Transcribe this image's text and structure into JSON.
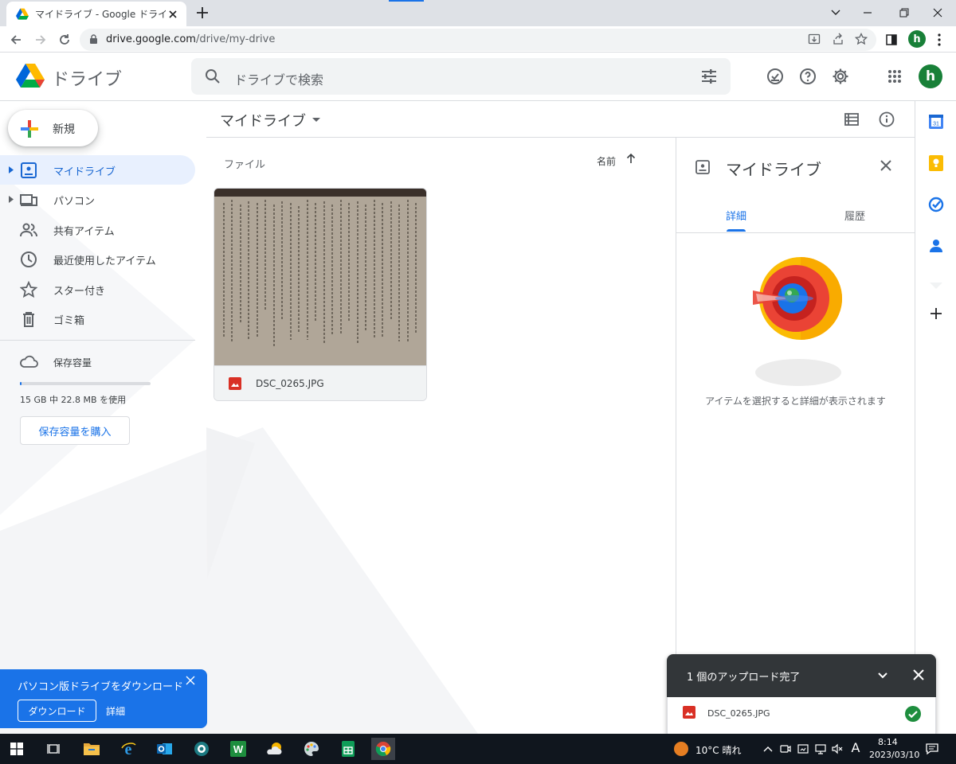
{
  "browser": {
    "tab_title": "マイドライブ - Google ドライブ",
    "url_host": "drive.google.com",
    "url_path": "/drive/my-drive",
    "profile_initial": "h"
  },
  "header": {
    "brand": "ドライブ",
    "search_placeholder": "ドライブで検索",
    "account_initial": "h"
  },
  "sidebar": {
    "new_label": "新規",
    "items": [
      {
        "label": "マイドライブ",
        "icon": "my-drive-icon",
        "active": true
      },
      {
        "label": "パソコン",
        "icon": "computers-icon",
        "active": false
      },
      {
        "label": "共有アイテム",
        "icon": "shared-icon",
        "active": false
      },
      {
        "label": "最近使用したアイテム",
        "icon": "clock-icon",
        "active": false
      },
      {
        "label": "スター付き",
        "icon": "star-icon",
        "active": false
      },
      {
        "label": "ゴミ箱",
        "icon": "trash-icon",
        "active": false
      }
    ],
    "storage_label": "保存容量",
    "storage_usage_text": "15 GB 中 22.8 MB を使用",
    "storage_fraction": 0.0015,
    "buy_storage_label": "保存容量を購入"
  },
  "main": {
    "breadcrumb": "マイドライブ",
    "files_header": "ファイル",
    "sort_label": "名前",
    "files": [
      {
        "name": "DSC_0265.JPG",
        "type": "image"
      }
    ]
  },
  "details": {
    "title": "マイドライブ",
    "tab_details": "詳細",
    "tab_history": "履歴",
    "empty_message": "アイテムを選択すると詳細が表示されます"
  },
  "promo": {
    "title": "パソコン版ドライブをダウンロード",
    "download_label": "ダウンロード",
    "detail_label": "詳細"
  },
  "upload": {
    "title": "1 個のアップロード完了",
    "file_name": "DSC_0265.JPG"
  },
  "taskbar": {
    "weather": "10°C  晴れ",
    "ime": "A",
    "time": "8:14",
    "date": "2023/03/10"
  },
  "colors": {
    "accent": "#1a73e8",
    "active_bg": "#e8f0fe",
    "upload_header": "#323639",
    "success": "#1e8e3e"
  }
}
